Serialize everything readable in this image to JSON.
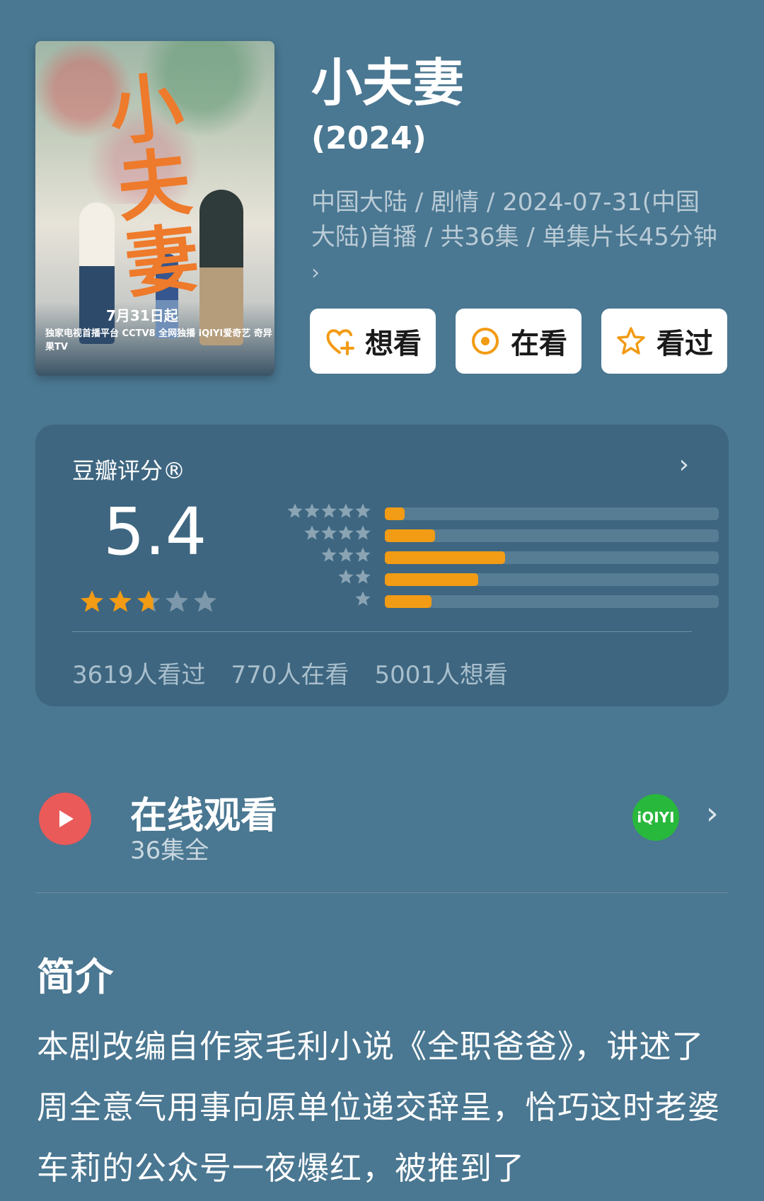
{
  "poster": {
    "title": "小夫妻",
    "date_text": "7月31日起",
    "logos": "独家电视首播平台 CCTV8  全网独播 iQIYI爱奇艺 奇异果TV"
  },
  "header": {
    "title": "小夫妻",
    "year": "(2024)",
    "meta": "中国大陆 / 剧情 / 2024-07-31(中国大陆)首播 / 共36集 / 单集片长45分钟",
    "meta_chevron": "›"
  },
  "actions": [
    {
      "label": "想看",
      "icon": "heart-plus-icon"
    },
    {
      "label": "在看",
      "icon": "target-icon"
    },
    {
      "label": "看过",
      "icon": "star-outline-icon"
    }
  ],
  "rating": {
    "label": "豆瓣评分®",
    "score": "5.4",
    "stars_value": 2.7,
    "stars_max": 5,
    "distribution": [
      {
        "stars": "★★★★★",
        "fraction": 0.06
      },
      {
        "stars": "★★★★",
        "fraction": 0.15
      },
      {
        "stars": "★★★",
        "fraction": 0.36
      },
      {
        "stars": "★★",
        "fraction": 0.28
      },
      {
        "stars": "★",
        "fraction": 0.14
      }
    ],
    "counts": [
      "3619人看过",
      "770人在看",
      "5001人想看"
    ]
  },
  "watch": {
    "title": "在线观看",
    "subtitle": "36集全",
    "provider": "iQIYI"
  },
  "intro": {
    "heading": "简介",
    "text": "本剧改编自作家毛利小说《全职爸爸》，讲述了周全意气用事向原单位递交辞呈，恰巧这时老婆车莉的公众号一夜爆红，被推到了"
  },
  "colors": {
    "background": "#4a7791",
    "card": "#3e6680",
    "accent": "#f29b14",
    "play": "#e95a59",
    "iqiyi": "#28b83c"
  }
}
